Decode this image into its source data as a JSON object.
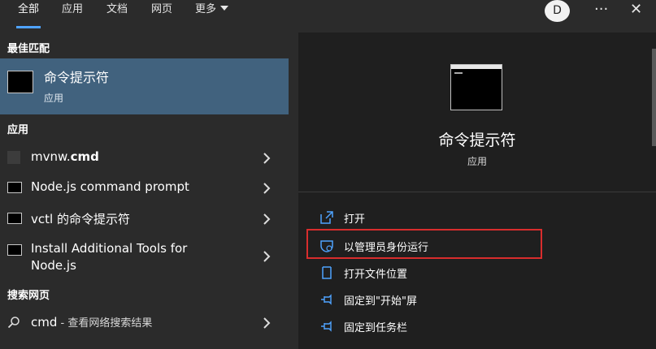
{
  "tabs": [
    {
      "label": "全部"
    },
    {
      "label": "应用"
    },
    {
      "label": "文档"
    },
    {
      "label": "网页"
    },
    {
      "label": "更多"
    }
  ],
  "header": {
    "avatar": "D",
    "more": "···",
    "close": "✕"
  },
  "sections": {
    "best": "最佳匹配",
    "apps": "应用",
    "web": "搜索网页"
  },
  "best_match": {
    "title": "命令提示符",
    "subtitle": "应用"
  },
  "apps": [
    {
      "name": "mvnw.",
      "bold": "cmd"
    },
    {
      "name": "Node.js command prompt"
    },
    {
      "name": "vctl 的命令提示符"
    },
    {
      "name": "Install Additional Tools for",
      "name2": "Node.js"
    }
  ],
  "web": {
    "query": "cmd",
    "suffix": " - 查看网络搜索结果"
  },
  "detail": {
    "title": "命令提示符",
    "subtitle": "应用",
    "actions": [
      {
        "label": "打开",
        "icon": "open-icon"
      },
      {
        "label": "以管理员身份运行",
        "icon": "shield-icon"
      },
      {
        "label": "打开文件位置",
        "icon": "file-location-icon"
      },
      {
        "label": "固定到\"开始\"屏",
        "icon": "pin-icon"
      },
      {
        "label": "固定到任务栏",
        "icon": "pin-icon"
      }
    ]
  },
  "colors": {
    "accent": "#4fa3ff",
    "selection": "#41627e",
    "highlight_border": "#d82d2d"
  }
}
